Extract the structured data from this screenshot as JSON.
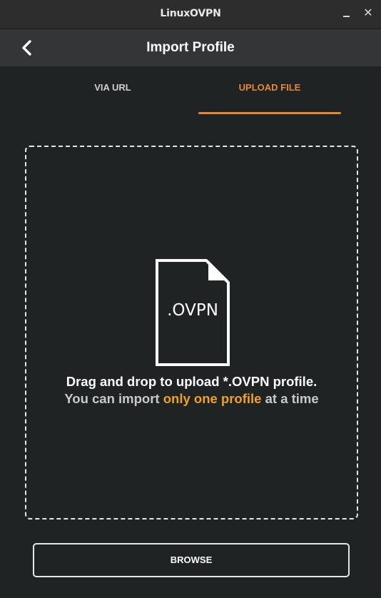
{
  "window": {
    "title": "LinuxOVPN",
    "minimize_icon": "minimize-icon",
    "close_glyph": "✕"
  },
  "header": {
    "title": "Import Profile",
    "back_icon": "chevron-left-icon"
  },
  "tabs": [
    {
      "label": "VIA URL",
      "active": false
    },
    {
      "label": "UPLOAD FILE",
      "active": true
    }
  ],
  "dropzone": {
    "file_icon_label": ".OVPN",
    "line1": "Drag and drop to upload *.OVPN profile.",
    "line2_prefix": "You can import ",
    "line2_highlight": "only one profile",
    "line2_suffix": " at a time"
  },
  "browse_label": "BROWSE",
  "colors": {
    "background": "#202324",
    "header": "#333537",
    "accent": "#e8892f",
    "highlight": "#f0a21c"
  }
}
